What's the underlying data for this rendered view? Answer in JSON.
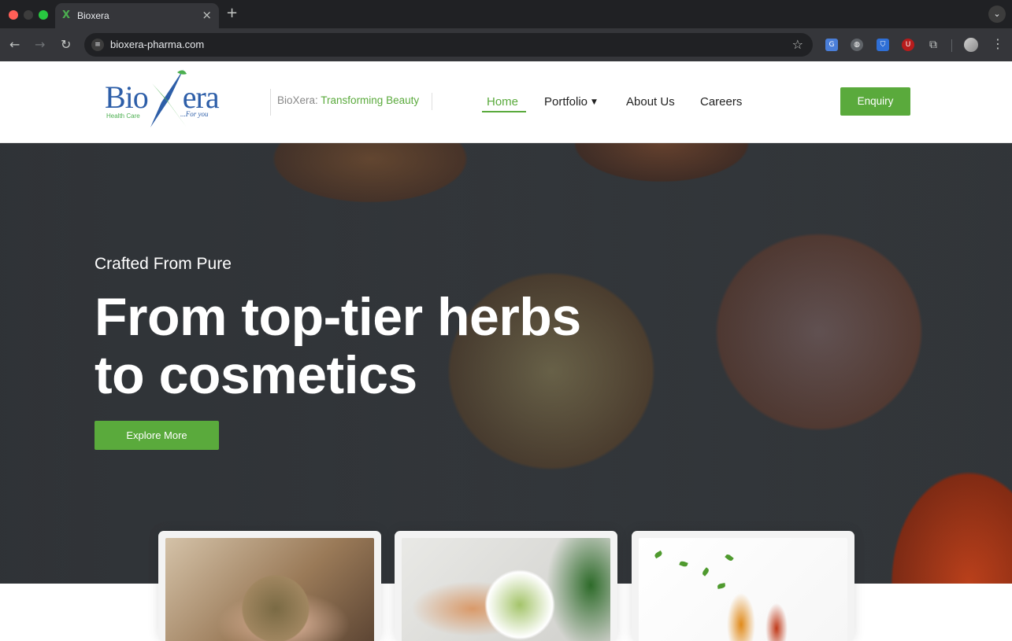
{
  "browser": {
    "tab_title": "Bioxera",
    "tab_favicon": "X",
    "url": "bioxera-pharma.com",
    "icons": [
      "close-icon",
      "plus-icon",
      "back-arrow-icon",
      "forward-arrow-icon",
      "reload-icon",
      "site-info-icon",
      "star-icon",
      "translate-icon",
      "globe-icon",
      "shield-icon",
      "ublock-icon",
      "puzzle-icon",
      "profile-icon",
      "kebab-icon",
      "chevron-down-icon"
    ]
  },
  "site": {
    "logo": {
      "wordmark_left": "Bio",
      "wordmark_right": "era",
      "subtitle": "Health Care",
      "tagline": "...For you"
    },
    "tagline": {
      "brand": "BioXera:",
      "text": "Transforming Beauty"
    },
    "nav": {
      "items": [
        {
          "label": "Home",
          "active": true
        },
        {
          "label": "Portfolio",
          "has_dropdown": true
        },
        {
          "label": "About Us"
        },
        {
          "label": "Careers"
        }
      ],
      "cta": "Enquiry"
    },
    "hero": {
      "pretitle": "Crafted From Pure",
      "title_line1": "From top-tier herbs",
      "title_line2": "to cosmetics",
      "button": "Explore More"
    },
    "colors": {
      "accent": "#5aaa3c",
      "brand_blue": "#2d5ea8"
    }
  }
}
